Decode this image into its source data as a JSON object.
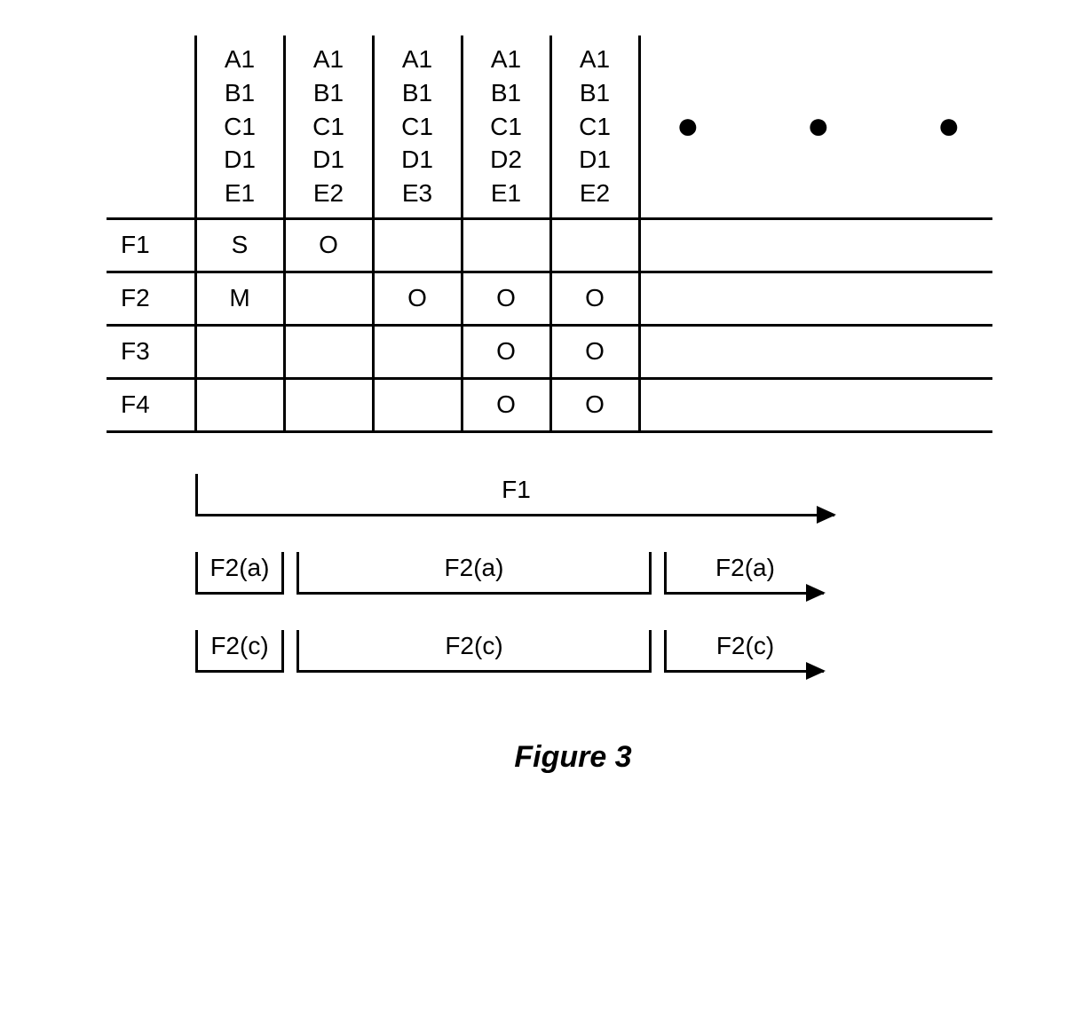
{
  "table": {
    "columns": [
      [
        "A1",
        "B1",
        "C1",
        "D1",
        "E1"
      ],
      [
        "A1",
        "B1",
        "C1",
        "D1",
        "E2"
      ],
      [
        "A1",
        "B1",
        "C1",
        "D1",
        "E3"
      ],
      [
        "A1",
        "B1",
        "C1",
        "D2",
        "E1"
      ],
      [
        "A1",
        "B1",
        "C1",
        "D1",
        "E2"
      ]
    ],
    "ellipsis": "●   ●   ●",
    "rows": [
      {
        "label": "F1",
        "cells": [
          "S",
          "O",
          "",
          "",
          ""
        ]
      },
      {
        "label": "F2",
        "cells": [
          "M",
          "",
          "O",
          "O",
          "O"
        ]
      },
      {
        "label": "F3",
        "cells": [
          "",
          "",
          "",
          "O",
          "O"
        ]
      },
      {
        "label": "F4",
        "cells": [
          "",
          "",
          "",
          "O",
          "O"
        ]
      }
    ]
  },
  "arrows": {
    "r1": {
      "label": "F1"
    },
    "r2": {
      "a": "F2(a)",
      "b": "F2(a)",
      "c": "F2(a)"
    },
    "r3": {
      "a": "F2(c)",
      "b": "F2(c)",
      "c": "F2(c)"
    }
  },
  "caption": "Figure 3"
}
